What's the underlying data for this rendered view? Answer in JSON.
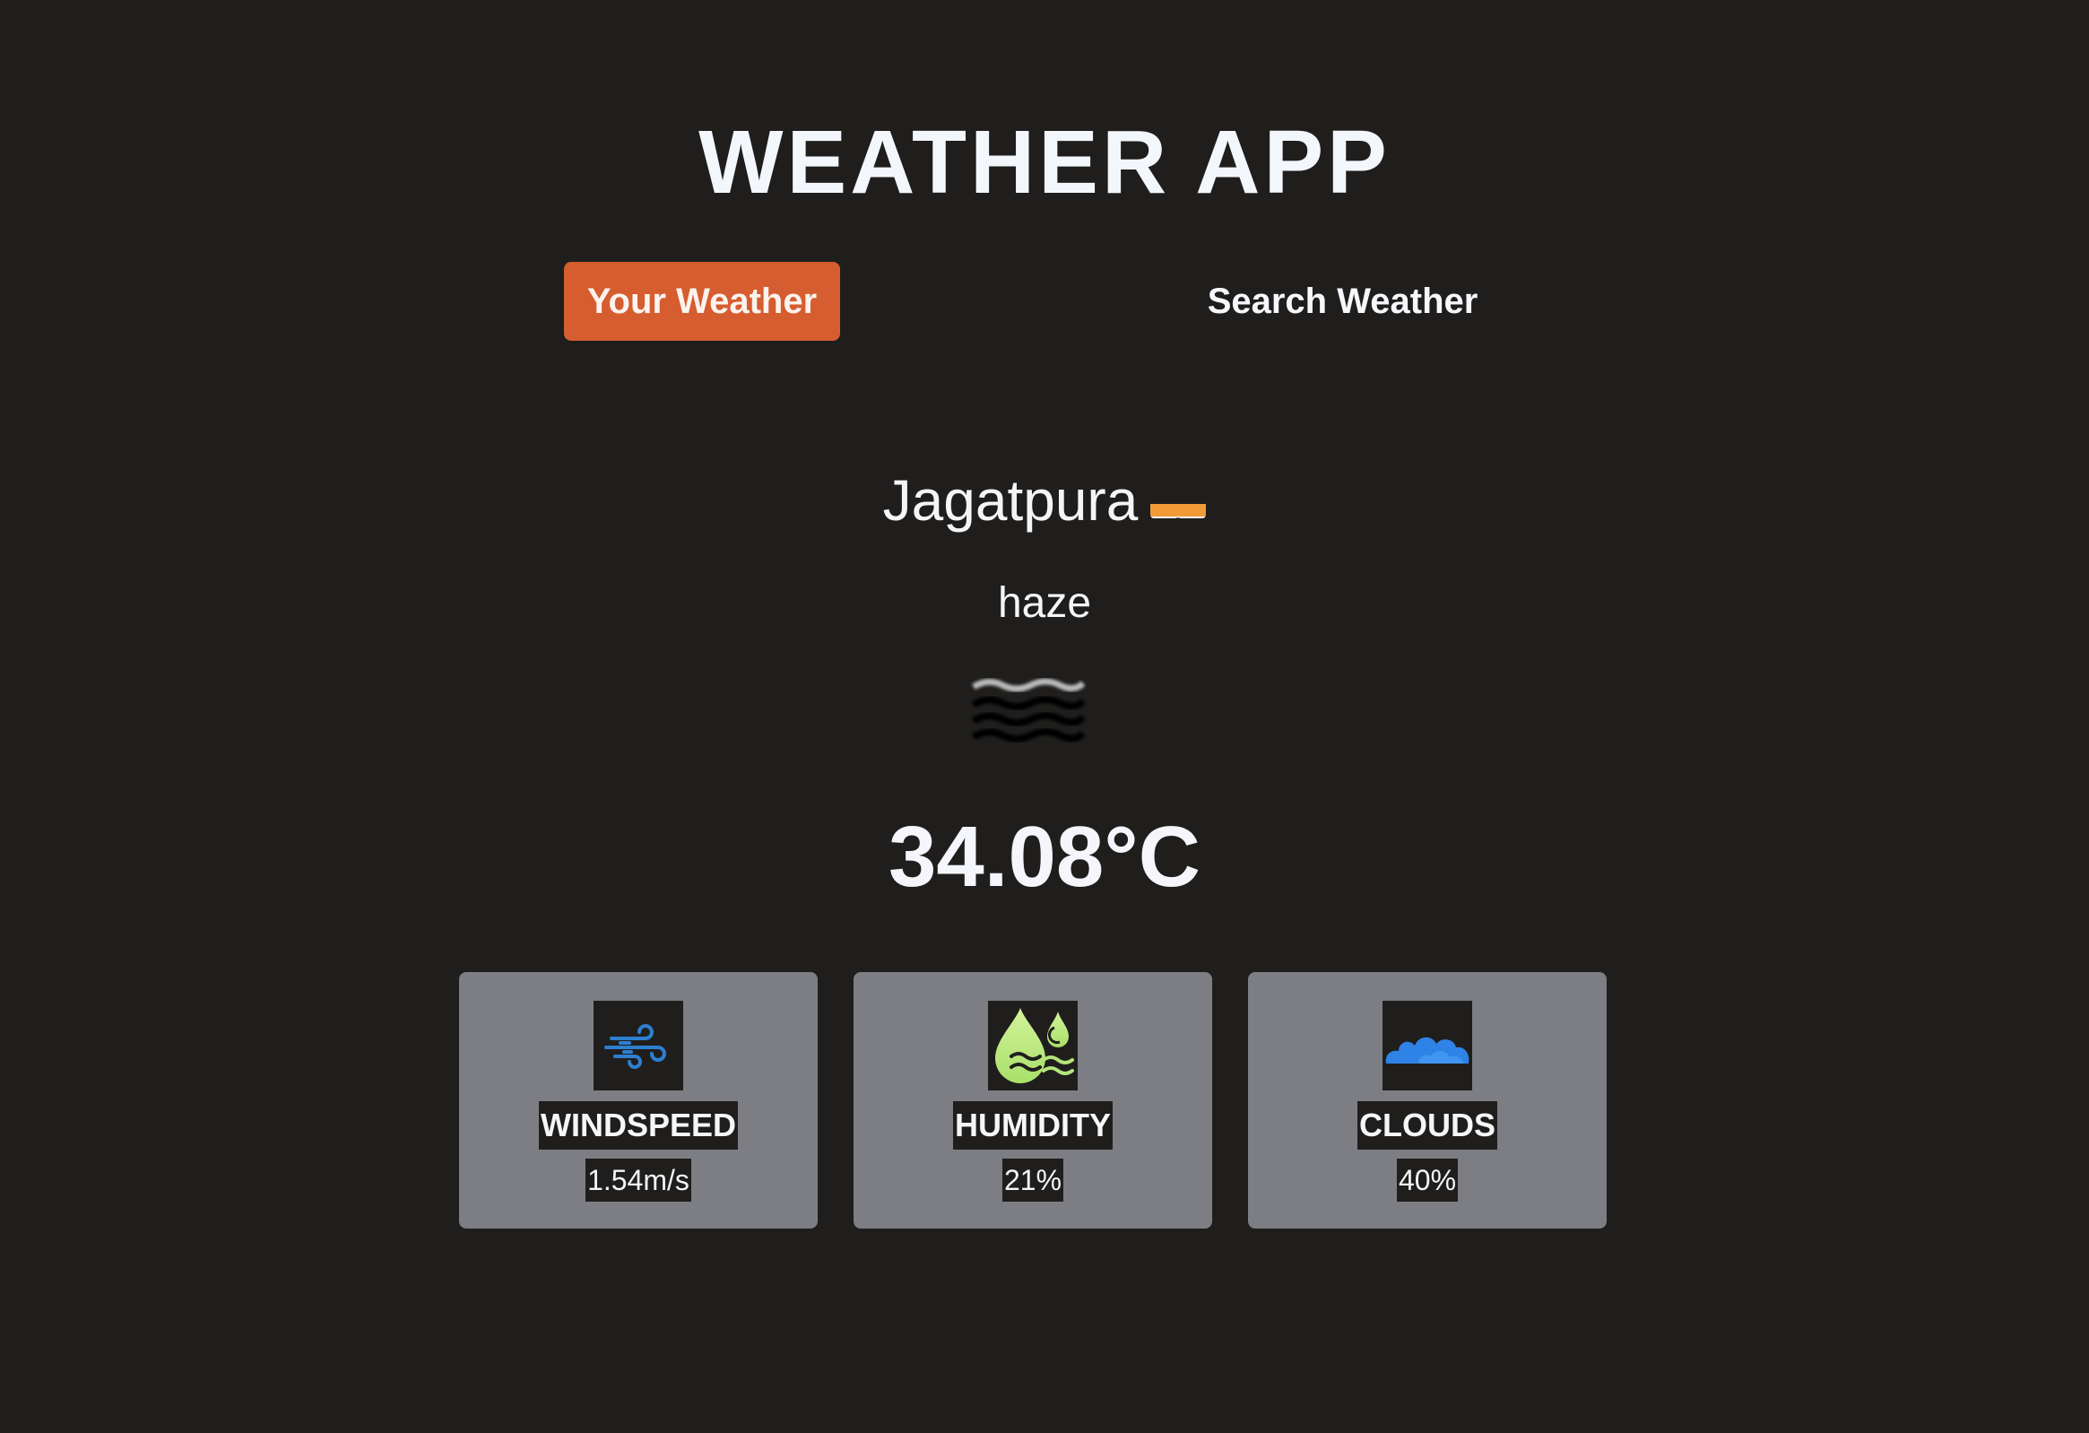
{
  "app": {
    "title": "WEATHER APP"
  },
  "tabs": [
    {
      "label": "Your Weather",
      "active": true
    },
    {
      "label": "Search Weather",
      "active": false
    }
  ],
  "weather": {
    "city": "Jagatpura",
    "country_flag": "India flag",
    "description": "haze",
    "condition_icon": "haze-icon",
    "temperature": "34.08°C"
  },
  "stats": [
    {
      "label": "WINDSPEED",
      "value": "1.54m/s",
      "icon": "wind-icon"
    },
    {
      "label": "HUMIDITY",
      "value": "21%",
      "icon": "humidity-icon"
    },
    {
      "label": "CLOUDS",
      "value": "40%",
      "icon": "cloud-icon"
    }
  ],
  "colors": {
    "background": "#1f1e1d",
    "accent": "#d65d30",
    "card": "#7d7e83"
  }
}
